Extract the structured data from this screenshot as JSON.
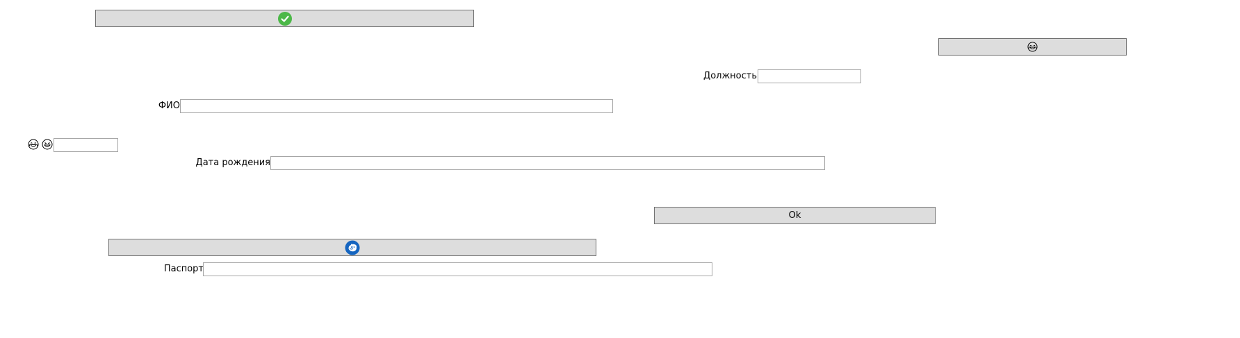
{
  "buttons": {
    "top_check": {
      "icon": "check-circle-icon",
      "color": "#4cb848"
    },
    "top_right_emoji": {
      "icon": "laughing-emoji-icon"
    },
    "ok": {
      "label": "Ok"
    },
    "blue_icon": {
      "icon": "fist-circle-icon",
      "color": "#1565c0"
    }
  },
  "fields": {
    "position": {
      "label": "Должность",
      "value": ""
    },
    "fio": {
      "label": "ФИО",
      "value": ""
    },
    "small": {
      "value": ""
    },
    "birth_date": {
      "label": "Дата рождения",
      "value": ""
    },
    "passport": {
      "label": "Паспорт",
      "value": ""
    }
  },
  "emojis": [
    "laughing-emoji-icon",
    "grinning-emoji-icon"
  ]
}
